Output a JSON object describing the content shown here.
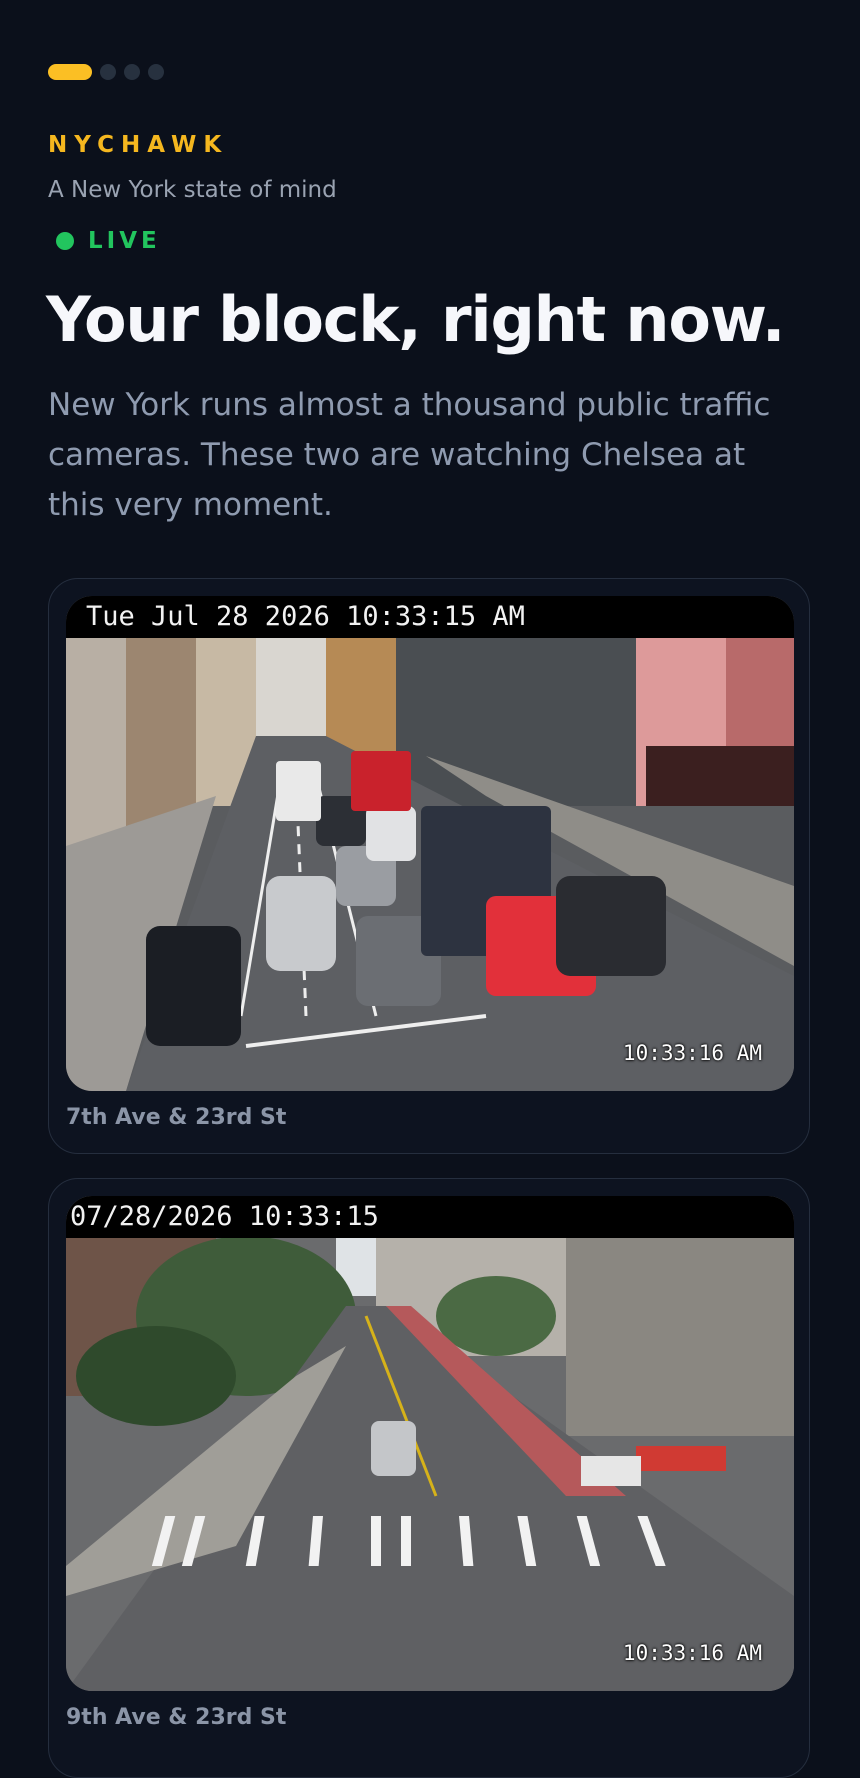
{
  "carousel": {
    "count": 4,
    "active_index": 0
  },
  "brand": {
    "name": "NYCHAWK",
    "tagline": "A New York state of mind"
  },
  "status": {
    "label": "LIVE"
  },
  "hero": {
    "headline": "Your block, right now.",
    "intro": "New York runs almost a thousand public traffic cameras. These two are watching Chelsea at this very moment."
  },
  "cameras": [
    {
      "overlay_timestamp": "Tue Jul 28 2026 10:33:15 AM",
      "corner_time": "10:33:16 AM",
      "label": "7th Ave & 23rd St"
    },
    {
      "overlay_timestamp": "07/28/2026 10:33:15",
      "corner_time": "10:33:16 AM",
      "label": "9th Ave & 23rd St"
    }
  ],
  "colors": {
    "background": "#0b101b",
    "accent": "#fbbf24",
    "live": "#22c55e"
  }
}
